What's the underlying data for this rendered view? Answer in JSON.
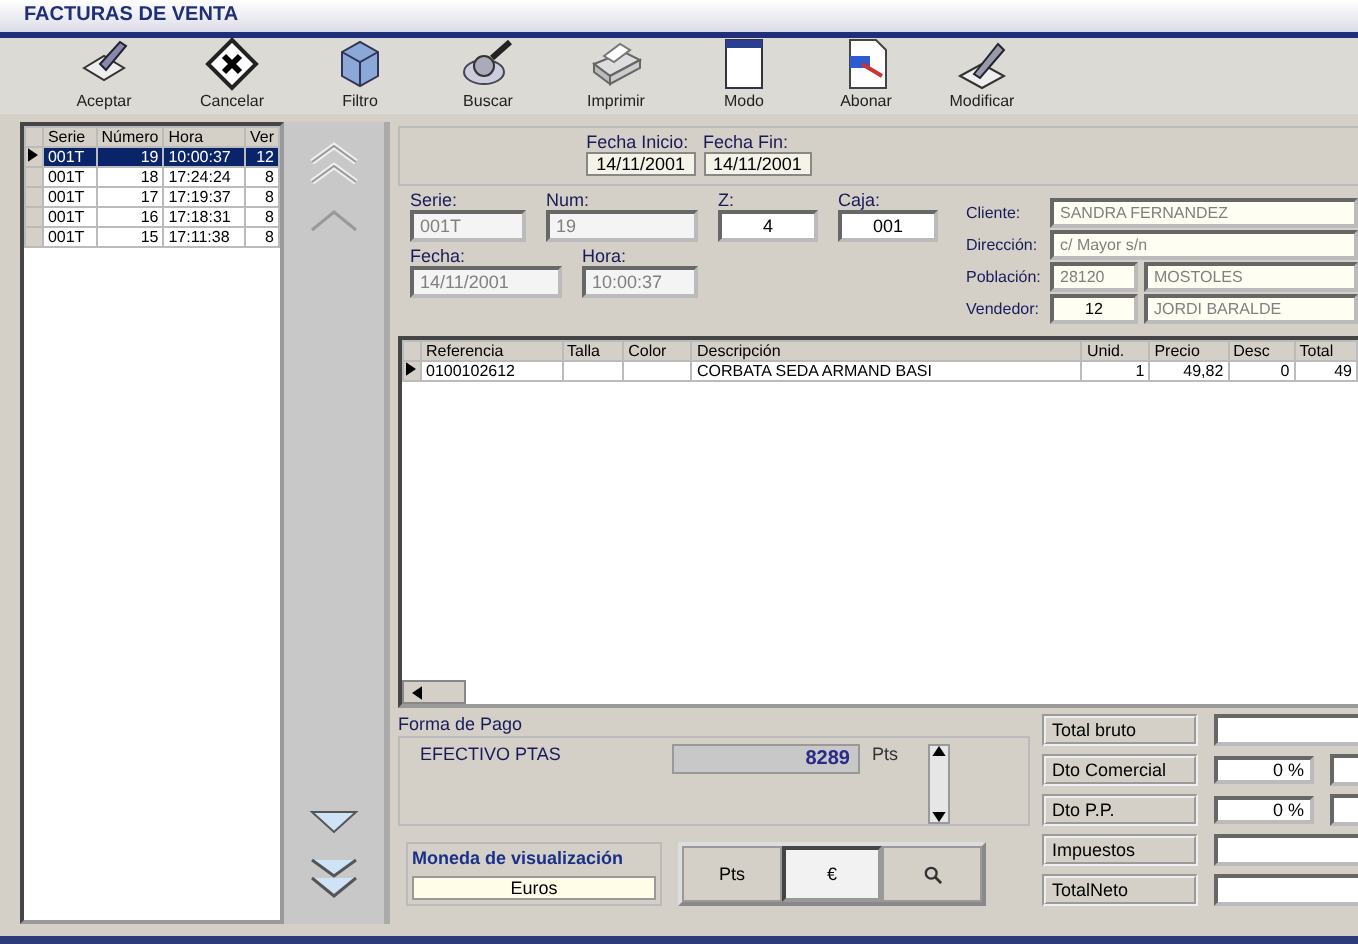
{
  "window": {
    "title": "FACTURAS DE VENTA"
  },
  "toolbar": [
    {
      "label": "Aceptar"
    },
    {
      "label": "Cancelar"
    },
    {
      "label": "Filtro"
    },
    {
      "label": "Buscar"
    },
    {
      "label": "Imprimir"
    },
    {
      "label": "Modo"
    },
    {
      "label": "Abonar"
    },
    {
      "label": "Modificar"
    }
  ],
  "invoices": {
    "columns": [
      "Serie",
      "Número",
      "Hora",
      "Ver"
    ],
    "rows": [
      {
        "cells": [
          "001T",
          "19",
          "10:00:37",
          "12"
        ],
        "selected": true
      },
      {
        "cells": [
          "001T",
          "18",
          "17:24:24",
          "8"
        ],
        "selected": false
      },
      {
        "cells": [
          "001T",
          "17",
          "17:19:37",
          "8"
        ],
        "selected": false
      },
      {
        "cells": [
          "001T",
          "16",
          "17:18:31",
          "8"
        ],
        "selected": false
      },
      {
        "cells": [
          "001T",
          "15",
          "17:11:38",
          "8"
        ],
        "selected": false
      }
    ]
  },
  "date_range": [
    {
      "label": "Fecha Inicio:",
      "value": "14/11/2001"
    },
    {
      "label": "Fecha Fin:",
      "value": "14/11/2001"
    }
  ],
  "document_fields": [
    [
      {
        "label": "Serie:",
        "value": "001T",
        "disabled": true
      },
      {
        "label": "Num:",
        "value": "19",
        "disabled": true
      },
      {
        "label": "Z:",
        "value": "4",
        "disabled": false
      },
      {
        "label": "Caja:",
        "value": "001",
        "disabled": false
      }
    ],
    [
      {
        "label": "Fecha:",
        "value": "14/11/2001",
        "disabled": true
      },
      {
        "label": "Hora:",
        "value": "10:00:37",
        "disabled": true
      }
    ]
  ],
  "customer_fields": [
    {
      "label": "Cliente:",
      "values": [
        {
          "value": "SANDRA FERNANDEZ",
          "disabled": true
        }
      ]
    },
    {
      "label": "Dirección:",
      "values": [
        {
          "value": "c/ Mayor s/n",
          "disabled": true
        }
      ]
    },
    {
      "label": "Población:",
      "values": [
        {
          "value": "28120",
          "disabled": true
        },
        {
          "value": "MOSTOLES",
          "disabled": true
        }
      ]
    },
    {
      "label": "Vendedor:",
      "values": [
        {
          "value": "12",
          "disabled": false
        },
        {
          "value": "JORDI BARALDE",
          "disabled": true
        }
      ]
    }
  ],
  "lines": {
    "columns": [
      "Referencia",
      "Talla",
      "Color",
      "Descripción",
      "Unid.",
      "Precio",
      "Desc",
      "Total"
    ],
    "rows": [
      {
        "cells": [
          "0100102612",
          "",
          "",
          "CORBATA SEDA ARMAND BASI",
          "1",
          "49,82",
          "0",
          "49"
        ],
        "selected": true
      }
    ]
  },
  "payment": {
    "title": "Forma de Pago",
    "method": "EFECTIVO PTAS",
    "amount": "8289",
    "currency": "Pts"
  },
  "display_currency": {
    "title": "Moneda de visualización",
    "value": "Euros",
    "buttons": [
      {
        "label": "Pts",
        "kind": "text",
        "selected": false
      },
      {
        "label": "€",
        "kind": "text",
        "selected": true
      },
      {
        "kind": "search",
        "selected": false
      }
    ]
  },
  "totals": [
    {
      "label": "Total bruto"
    },
    {
      "label": "Dto Comercial",
      "percent": "0 %"
    },
    {
      "label": "Dto P.P.",
      "percent": "0 %"
    },
    {
      "label": "Impuestos"
    },
    {
      "label": "TotalNeto"
    }
  ]
}
